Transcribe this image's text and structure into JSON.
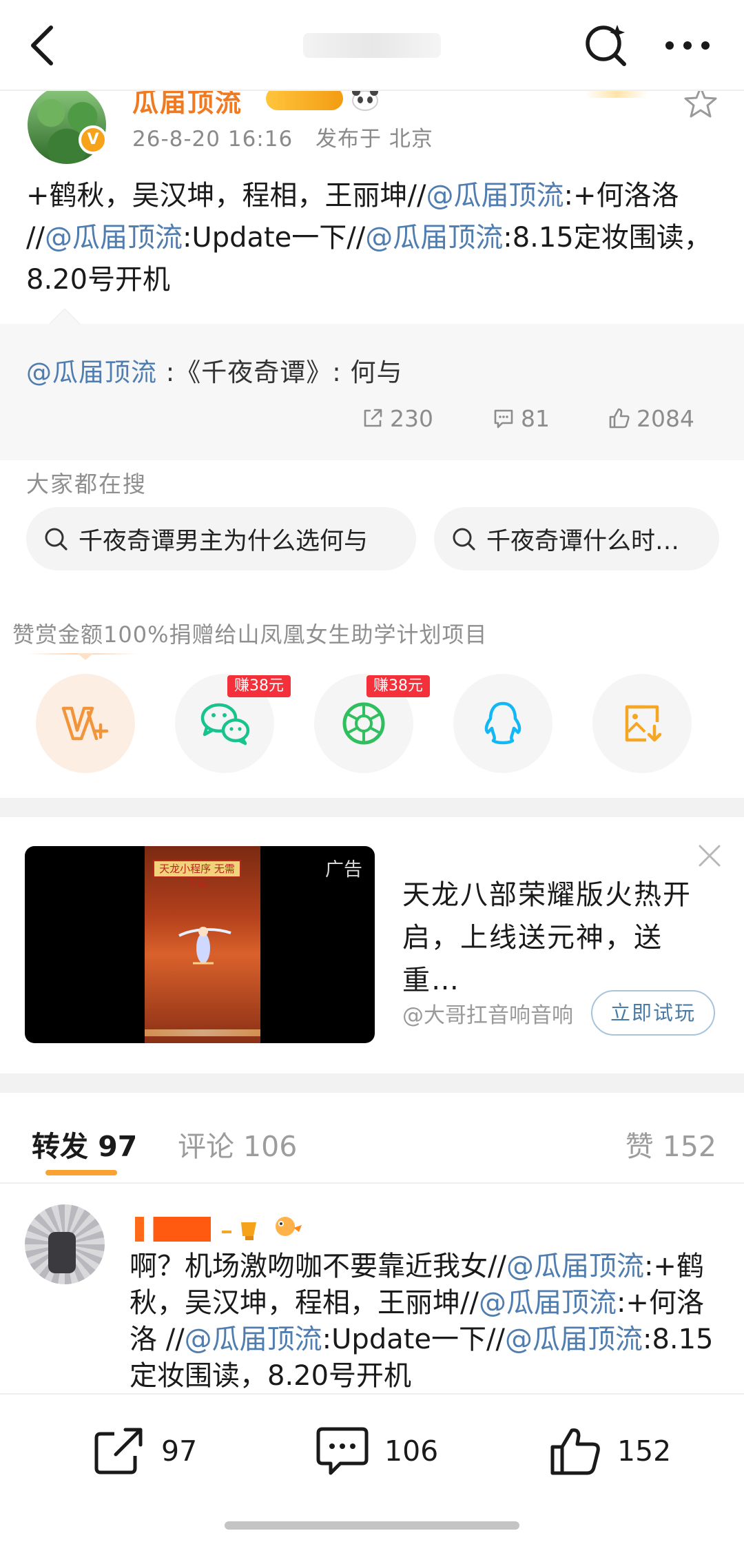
{
  "header": {
    "back_icon": "chevron-left-icon",
    "search_icon": "search-sparkle-icon",
    "more_icon": "more-dots-icon"
  },
  "author": {
    "name": "瓜届顶流",
    "verified": "V",
    "time": "26-8-20 16:16",
    "location": "发布于 北京"
  },
  "post": {
    "parts": [
      "+鹤秋，吴汉坤，程相，王丽坤//",
      "@瓜届顶流",
      ":+何洛洛 //",
      "@瓜届顶流",
      ":Update一下//",
      "@瓜届顶流",
      ":8.15定妆围读，8.20号开机"
    ]
  },
  "quote": {
    "mention": "@瓜届顶流",
    "text": " :《千夜奇谭》: 何与",
    "reposts": "230",
    "comments": "81",
    "likes": "2084"
  },
  "hot_search": {
    "label": "大家都在搜",
    "chips": [
      "千夜奇谭男主为什么选何与",
      "千夜奇谭什么时候播出"
    ]
  },
  "reward": {
    "label": "赞赏金额100%捐赠给山凤凰女生助学计划项目",
    "earn_tag": "赚38元"
  },
  "ad": {
    "tag": "广告",
    "frame_tag": "天龙小程序 无需下载",
    "title": "天龙八部荣耀版火热开启，上线送元神，送重…",
    "source": "@大哥扛音响音响",
    "cta": "立即试玩"
  },
  "tabs": {
    "repost": "转发 97",
    "comment": "评论 106",
    "like": "赞 152"
  },
  "comment": {
    "parts": [
      "啊？机场激吻咖不要靠近我女//",
      "@瓜届顶流",
      ":+鹤秋，吴汉坤，程相，王丽坤//",
      "@瓜届顶流",
      ":+何洛洛 //",
      "@瓜届顶流",
      ":Update一下//",
      "@瓜届顶流",
      ":8.15定妆围读，8.20号开机"
    ]
  },
  "bottom_bar": {
    "reposts": "97",
    "comments": "106",
    "likes": "152"
  },
  "colors": {
    "mention": "#507daf",
    "author_name": "#f07a21",
    "tab_underline": "#f7a232",
    "earn_tag": "#f4303a"
  }
}
